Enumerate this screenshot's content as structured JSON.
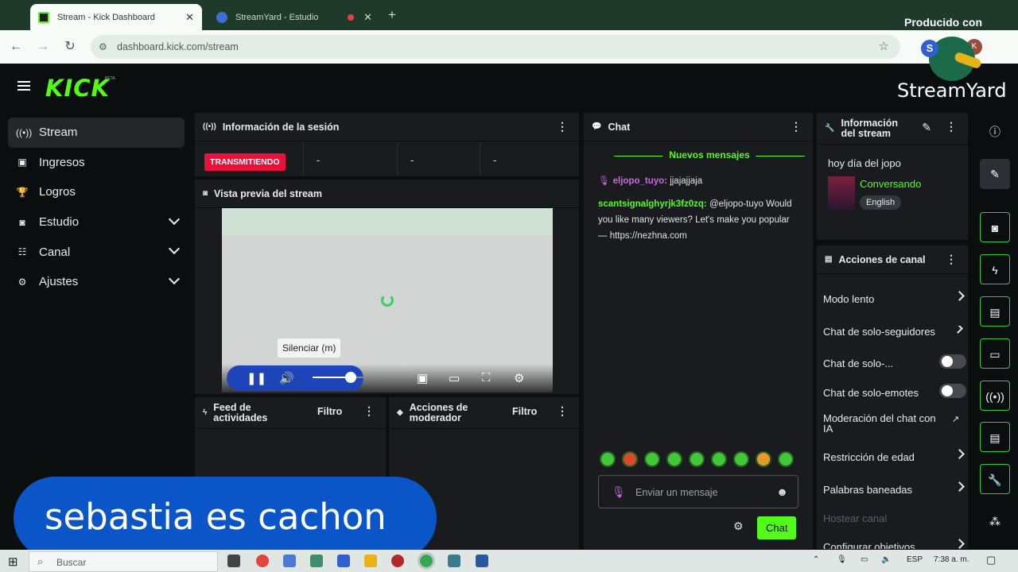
{
  "browser": {
    "tabs": [
      {
        "title": "Stream - Kick Dashboard",
        "close": "✕"
      },
      {
        "title": "StreamYard - Estudio",
        "close": "✕"
      }
    ],
    "new_tab": "+",
    "url": "dashboard.kick.com/stream",
    "profile_initial": "K"
  },
  "app": {
    "logo": "KICK",
    "beta": "BETA",
    "nav": [
      {
        "label": "Stream",
        "icon": "broadcast-icon"
      },
      {
        "label": "Ingresos",
        "icon": "wallet-icon"
      },
      {
        "label": "Logros",
        "icon": "trophy-icon"
      },
      {
        "label": "Estudio",
        "icon": "studio-icon"
      },
      {
        "label": "Canal",
        "icon": "users-icon"
      },
      {
        "label": "Ajustes",
        "icon": "gear-icon"
      }
    ],
    "session": {
      "title": "Información de la sesión",
      "status": "TRANSMITIENDO",
      "stats": [
        "-",
        "-",
        "-"
      ]
    },
    "preview": {
      "title": "Vista previa del stream",
      "tooltip": "Silenciar (m)",
      "volume_fraction": 0.5
    },
    "feed": {
      "title": "Feed de actividades",
      "filter": "Filtro"
    },
    "mod_actions": {
      "title": "Acciones de moderador",
      "filter": "Filtro"
    },
    "chat": {
      "title": "Chat",
      "new_messages": "Nuevos mensajes",
      "messages": [
        {
          "user": "eljopo_tuyo:",
          "text": "jjajajjaja",
          "color": "#c86dd7"
        },
        {
          "user": "scantsignalghyrjk3fz0zq:",
          "text": "@eljopo-tuyo Would you like many viewers? Let's make you popular — https://nezhna.com",
          "color": "#53fc18"
        }
      ],
      "input_placeholder": "Enviar un mensaje",
      "send_label": "Chat"
    },
    "stream_info": {
      "title": "Información del stream",
      "stream_title": "hoy día del jopo",
      "category": "Conversando",
      "language": "English"
    },
    "channel_actions": {
      "title": "Acciones de canal",
      "items": [
        {
          "label": "Modo lento",
          "control": "arrow"
        },
        {
          "label": "Chat de solo-seguidores",
          "control": "arrow"
        },
        {
          "label": "Chat de solo-...",
          "control": "toggle"
        },
        {
          "label": "Chat de solo-emotes",
          "control": "toggle"
        },
        {
          "label": "Moderación del chat con IA",
          "control": "external"
        },
        {
          "label": "Restricción de edad",
          "control": "arrow"
        },
        {
          "label": "Palabras baneadas",
          "control": "arrow"
        },
        {
          "label": "Hostear canal",
          "control": "none"
        },
        {
          "label": "Configurar objetivos",
          "control": "arrow"
        }
      ]
    }
  },
  "overlay": {
    "caption": "sebastia es cachon",
    "produced_by": "Producido con",
    "brand": "StreamYard"
  },
  "taskbar": {
    "search_placeholder": "Buscar",
    "language": "ESP",
    "time": "7:38 a. m."
  },
  "colors": {
    "kick_green": "#53fc18",
    "live_red": "#e9113c",
    "caption_blue": "#0a56c8"
  }
}
